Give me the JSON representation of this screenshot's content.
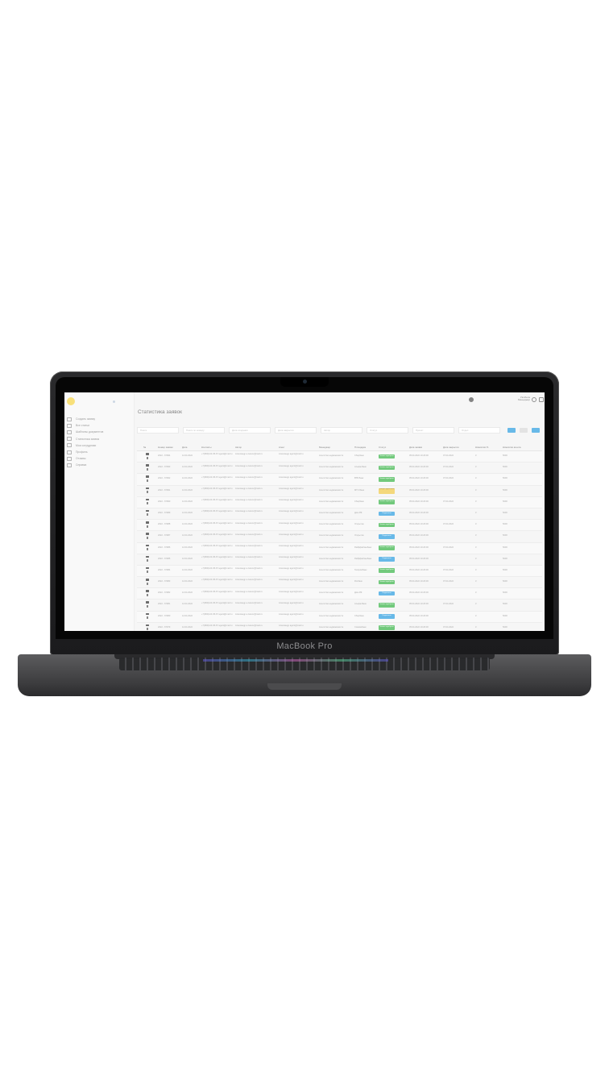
{
  "device": {
    "brand_label": "MacBook Pro"
  },
  "app": {
    "page_title": "Статистика заявок",
    "user": {
      "name": "Ув-Меса",
      "role": "Менеджер"
    },
    "sidebar": {
      "items": [
        {
          "label": "Создать заявку",
          "icon": "plus-icon"
        },
        {
          "label": "Все статьи",
          "icon": "list-icon"
        },
        {
          "label": "Шаблоны документов",
          "icon": "document-icon"
        },
        {
          "label": "Статистика заявок",
          "icon": "chart-icon"
        },
        {
          "label": "Мои сотрудники",
          "icon": "users-icon"
        },
        {
          "label": "Профиль",
          "icon": "user-icon"
        },
        {
          "label": "Отзывы",
          "icon": "star-icon"
        },
        {
          "label": "Справка",
          "icon": "help-icon"
        }
      ]
    },
    "filters": {
      "fields": [
        "Поиск",
        "Поиск по номеру",
        "Дата создания",
        "Дата закрытия",
        "Автор",
        "Статус",
        "Проект",
        "Отдел"
      ],
      "buttons": {
        "apply": "",
        "reset": "",
        "export": ""
      }
    },
    "table": {
      "headers": [
        "№",
        "Номер заявки",
        "Дата",
        "Контакты",
        "Автор",
        "Агент",
        "Менеджер",
        "Площадка",
        "Статус",
        "Дата заявки",
        "Дата закрытия",
        "Комиссия %",
        "Комиссия агента"
      ],
      "rows": [
        {
          "num": "1",
          "order": "2022 - 67994",
          "date": "12.04.2022",
          "contact": "+7(960)123-45-67 agent@mail.ru",
          "author": "Александр a.ivanov@mail.ru",
          "agent": "Александр agent@mail.ru",
          "manager": "Агентство недвижимости",
          "platform": "Сбербанк",
          "status": "Заявка одобрена",
          "status_color": "#3cb54a",
          "date_created": "05.04.2022 10:26:00",
          "date_closed": "07.04.2022",
          "commission": "3",
          "agent_commission": "5000"
        },
        {
          "num": "2",
          "order": "2022 - 67993",
          "date": "12.04.2022",
          "contact": "+7(960)123-45-67 agent@mail.ru",
          "author": "Александр a.ivanov@mail.ru",
          "agent": "Александр agent@mail.ru",
          "manager": "Агентство недвижимости",
          "platform": "Альфа-Банк",
          "status": "Заявка одобрена",
          "status_color": "#3cb54a",
          "date_created": "05.04.2022 10:26:00",
          "date_closed": "07.04.2022",
          "commission": "3",
          "agent_commission": "5000"
        },
        {
          "num": "3",
          "order": "2022 - 67992",
          "date": "12.04.2022",
          "contact": "+7(960)123-45-67 agent@mail.ru",
          "author": "Александр a.ivanov@mail.ru",
          "agent": "Александр agent@mail.ru",
          "manager": "Агентство недвижимости",
          "platform": "ВТБ Банк",
          "status": "Заявка одобрена",
          "status_color": "#3cb54a",
          "date_created": "05.04.2022 10:26:00",
          "date_closed": "07.04.2022",
          "commission": "3",
          "agent_commission": "5000"
        },
        {
          "num": "4",
          "order": "2022 - 67991",
          "date": "12.04.2022",
          "contact": "+7(960)123-45-67 agent@mail.ru",
          "author": "Александр a.ivanov@mail.ru",
          "agent": "Александр agent@mail.ru",
          "manager": "Агентство недвижимости",
          "platform": "МТС Банк",
          "status": "Требует доработки",
          "status_color": "#f0c94a",
          "date_created": "05.04.2022 10:26:00",
          "date_closed": "",
          "commission": "3",
          "agent_commission": "5000"
        },
        {
          "num": "5",
          "order": "2022 - 67990",
          "date": "12.04.2022",
          "contact": "+7(960)123-45-67 agent@mail.ru",
          "author": "Александр a.ivanov@mail.ru",
          "agent": "Александр agent@mail.ru",
          "manager": "Агентство недвижимости",
          "platform": "Сбербанк",
          "status": "Заявка одобрена",
          "status_color": "#3cb54a",
          "date_created": "05.04.2022 10:26:00",
          "date_closed": "07.04.2022",
          "commission": "3",
          "agent_commission": "5000"
        },
        {
          "num": "6",
          "order": "2022 - 67989",
          "date": "12.04.2022",
          "contact": "+7(960)123-45-67 agent@mail.ru",
          "author": "Александр a.ivanov@mail.ru",
          "agent": "Александр agent@mail.ru",
          "manager": "Агентство недвижимости",
          "platform": "Дом.РФ",
          "status": "Подписана",
          "status_color": "#2f9ee0",
          "date_created": "05.04.2022 10:26:00",
          "date_closed": "",
          "commission": "3",
          "agent_commission": "5000"
        },
        {
          "num": "7",
          "order": "2022 - 67988",
          "date": "12.04.2022",
          "contact": "+7(960)123-45-67 agent@mail.ru",
          "author": "Александр a.ivanov@mail.ru",
          "agent": "Александр agent@mail.ru",
          "manager": "Агентство недвижимости",
          "platform": "Открытие",
          "status": "Заявка одобрена",
          "status_color": "#3cb54a",
          "date_created": "05.04.2022 10:26:00",
          "date_closed": "07.04.2022",
          "commission": "3",
          "agent_commission": "5000"
        },
        {
          "num": "8",
          "order": "2022 - 67987",
          "date": "12.04.2022",
          "contact": "+7(960)123-45-67 agent@mail.ru",
          "author": "Александр a.ivanov@mail.ru",
          "agent": "Александр agent@mail.ru",
          "manager": "Агентство недвижимости",
          "platform": "Открытие",
          "status": "Подписана",
          "status_color": "#2f9ee0",
          "date_created": "05.04.2022 10:26:00",
          "date_closed": "",
          "commission": "3",
          "agent_commission": "5000"
        },
        {
          "num": "9",
          "order": "2022 - 67986",
          "date": "12.04.2022",
          "contact": "+7(960)123-45-67 agent@mail.ru",
          "author": "Александр a.ivanov@mail.ru",
          "agent": "Александр agent@mail.ru",
          "manager": "Агентство недвижимости",
          "platform": "Райффайзенбанк",
          "status": "Заявка одобрена",
          "status_color": "#3cb54a",
          "date_created": "05.04.2022 10:26:00",
          "date_closed": "07.04.2022",
          "commission": "3",
          "agent_commission": "5000"
        },
        {
          "num": "10",
          "order": "2022 - 67985",
          "date": "12.04.2022",
          "contact": "+7(960)123-45-67 agent@mail.ru",
          "author": "Александр a.ivanov@mail.ru",
          "agent": "Александр agent@mail.ru",
          "manager": "Агентство недвижимости",
          "platform": "Райффайзенбанк",
          "status": "Подписана",
          "status_color": "#2f9ee0",
          "date_created": "05.04.2022 10:26:00",
          "date_closed": "",
          "commission": "3",
          "agent_commission": "5000"
        },
        {
          "num": "11",
          "order": "2022 - 67984",
          "date": "12.04.2022",
          "contact": "+7(960)123-45-67 agent@mail.ru",
          "author": "Александр a.ivanov@mail.ru",
          "agent": "Александр agent@mail.ru",
          "manager": "Агентство недвижимости",
          "platform": "Газпромбанк",
          "status": "Заявка одобрена",
          "status_color": "#3cb54a",
          "date_created": "05.04.2022 10:26:00",
          "date_closed": "07.04.2022",
          "commission": "3",
          "agent_commission": "5000"
        },
        {
          "num": "12",
          "order": "2022 - 67983",
          "date": "12.04.2022",
          "contact": "+7(960)123-45-67 agent@mail.ru",
          "author": "Александр a.ivanov@mail.ru",
          "agent": "Александр agent@mail.ru",
          "manager": "Агентство недвижимости",
          "platform": "Росбанк",
          "status": "Заявка одобрена",
          "status_color": "#3cb54a",
          "date_created": "05.04.2022 10:26:00",
          "date_closed": "07.04.2022",
          "commission": "3",
          "agent_commission": "5000"
        },
        {
          "num": "13",
          "order": "2022 - 67982",
          "date": "12.04.2022",
          "contact": "+7(960)123-45-67 agent@mail.ru",
          "author": "Александр a.ivanov@mail.ru",
          "agent": "Александр agent@mail.ru",
          "manager": "Агентство недвижимости",
          "platform": "Дом.РФ",
          "status": "Подписана",
          "status_color": "#2f9ee0",
          "date_created": "05.04.2022 10:26:00",
          "date_closed": "",
          "commission": "3",
          "agent_commission": "5000"
        },
        {
          "num": "14",
          "order": "2022 - 67981",
          "date": "12.04.2022",
          "contact": "+7(960)123-45-67 agent@mail.ru",
          "author": "Александр a.ivanov@mail.ru",
          "agent": "Александр agent@mail.ru",
          "manager": "Агентство недвижимости",
          "platform": "Альфа-Банк",
          "status": "Заявка одобрена",
          "status_color": "#3cb54a",
          "date_created": "05.04.2022 10:26:00",
          "date_closed": "07.04.2022",
          "commission": "3",
          "agent_commission": "5000"
        },
        {
          "num": "15",
          "order": "2022 - 67980",
          "date": "12.04.2022",
          "contact": "+7(960)123-45-67 agent@mail.ru",
          "author": "Александр a.ivanov@mail.ru",
          "agent": "Александр agent@mail.ru",
          "manager": "Агентство недвижимости",
          "platform": "Сбербанк",
          "status": "Подписана",
          "status_color": "#2f9ee0",
          "date_created": "05.04.2022 10:26:00",
          "date_closed": "",
          "commission": "3",
          "agent_commission": "5000"
        },
        {
          "num": "16",
          "order": "2022 - 67979",
          "date": "12.04.2022",
          "contact": "+7(960)123-45-67 agent@mail.ru",
          "author": "Александр a.ivanov@mail.ru",
          "agent": "Александр agent@mail.ru",
          "manager": "Агентство недвижимости",
          "platform": "Совкомбанк",
          "status": "Заявка одобрена",
          "status_color": "#3cb54a",
          "date_created": "05.04.2022 10:26:00",
          "date_closed": "07.04.2022",
          "commission": "3",
          "agent_commission": "5000"
        }
      ]
    }
  },
  "colors": {
    "accent": "#2f9ee0",
    "approved": "#3cb54a",
    "pending": "#f0c94a",
    "logo": "#f5d547"
  }
}
